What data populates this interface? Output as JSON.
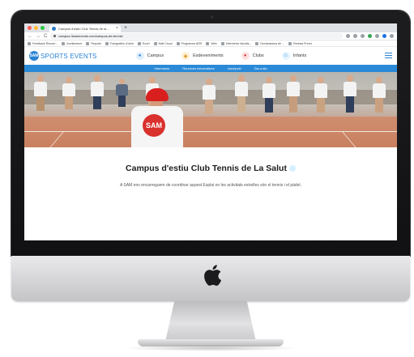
{
  "browser": {
    "tab_title": "Campus d'estiu Club Tennis de la ...",
    "tab_close": "×",
    "tab_new": "+",
    "url": "campus.3samevents.com/campus-de-tennis/",
    "back": "←",
    "forward": "→",
    "reload": "C",
    "bookmarks": [
      "Feedback Recom...",
      "Architecture",
      "Reports",
      "Fotografies d'obra",
      "Excel",
      "Mail Cloud",
      "Programes ARS",
      "Web",
      "Infermeria Vacuits...",
      "Declaracions de ...",
      "Revista Premi"
    ]
  },
  "site": {
    "logo_mark": "SAM",
    "logo_text": "SPORTS EVENTS",
    "nav": [
      {
        "label": "Campus",
        "icon": "tennis-ball-icon"
      },
      {
        "label": "Esdeveniments",
        "icon": "event-icon"
      },
      {
        "label": "Clubs",
        "icon": "club-icon"
      },
      {
        "label": "Infants",
        "icon": "kids-icon"
      }
    ],
    "subnav": [
      "Informació",
      "Reunions informatives",
      "Inscripció",
      "Dia a dia"
    ],
    "shirt_badge": "SAM",
    "page_title": "Campus d'estiu Club Tennis de La Salut",
    "page_desc": "A SAM ens encarreguem de coordinar aquest Esplai on les activitats estrelles són el tennis i el pàdel."
  },
  "colors": {
    "brand_blue": "#2a8ad8",
    "accent_red": "#d91e1e"
  }
}
